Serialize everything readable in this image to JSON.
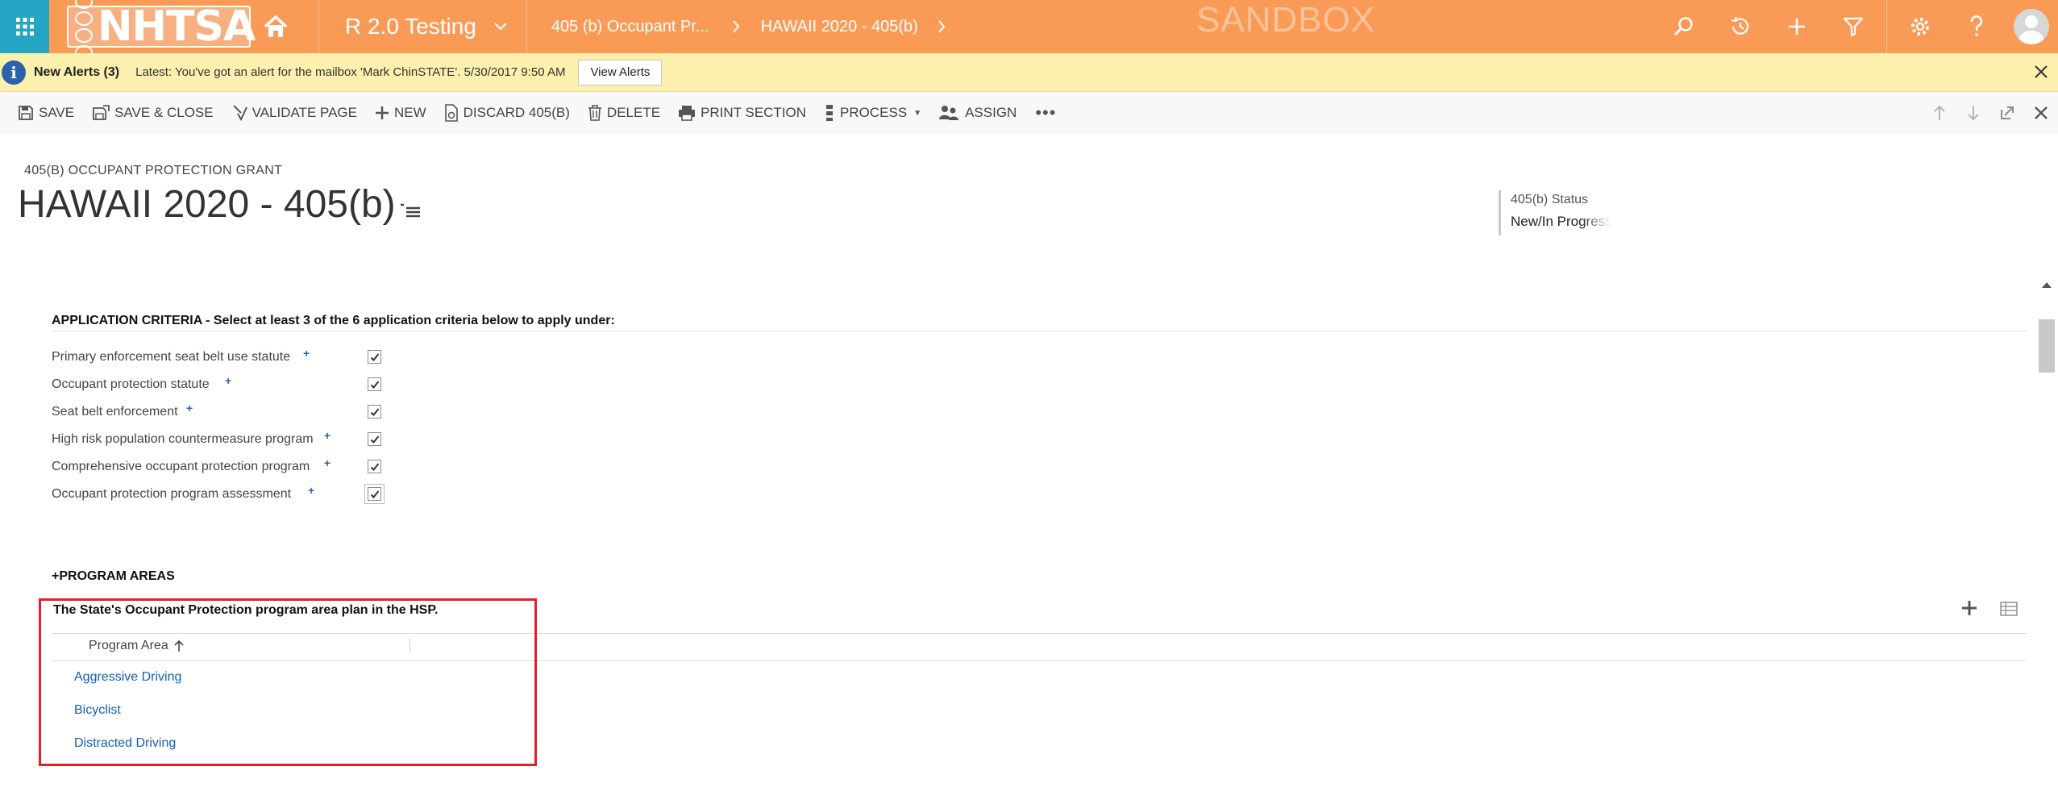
{
  "topbar": {
    "logo_text": "NHTSA",
    "area_title": "R 2.0 Testing",
    "breadcrumb_parent": "405 (b) Occupant Pr...",
    "breadcrumb_current": "HAWAII 2020 - 405(b)",
    "environment_watermark": "SANDBOX",
    "bg_color": "#f99b57",
    "grid_color": "#24a6c4"
  },
  "alerts": {
    "count_label": "New Alerts (3)",
    "message": "Latest: You've got an alert for the mailbox 'Mark ChinSTATE'. 5/30/2017 9:50 AM",
    "button_label": "View Alerts"
  },
  "commands": {
    "save": "SAVE",
    "save_close": "SAVE & CLOSE",
    "validate": "VALIDATE PAGE",
    "new": "NEW",
    "discard": "DISCARD 405(B)",
    "delete": "DELETE",
    "print": "PRINT SECTION",
    "process": "PROCESS",
    "assign": "ASSIGN",
    "more": "•••"
  },
  "header": {
    "entity_type": "405(B) OCCUPANT PROTECTION GRANT",
    "title": "HAWAII 2020 - 405(b)",
    "status_label": "405(b) Status",
    "status_value": "New/In Progress"
  },
  "criteria": {
    "title": "APPLICATION CRITERIA - Select at least 3 of the 6 application criteria below to apply under:",
    "items": [
      {
        "label": "Primary enforcement seat belt use statute",
        "checked": true
      },
      {
        "label": "Occupant protection statute",
        "checked": true
      },
      {
        "label": "Seat belt enforcement",
        "checked": true
      },
      {
        "label": "High risk population countermeasure program",
        "checked": true
      },
      {
        "label": "Comprehensive occupant protection program",
        "checked": true
      },
      {
        "label": "Occupant protection program assessment",
        "checked": true
      }
    ],
    "required_mark": "+"
  },
  "program_areas": {
    "section_title": "+PROGRAM AREAS",
    "subgrid_title": "The State's Occupant Protection program area plan in the HSP.",
    "column_header": "Program Area",
    "rows": [
      "Aggressive Driving",
      "Bicyclist",
      "Distracted Driving"
    ],
    "link_color": "#1160b7",
    "highlight_color": "#e0202a"
  }
}
